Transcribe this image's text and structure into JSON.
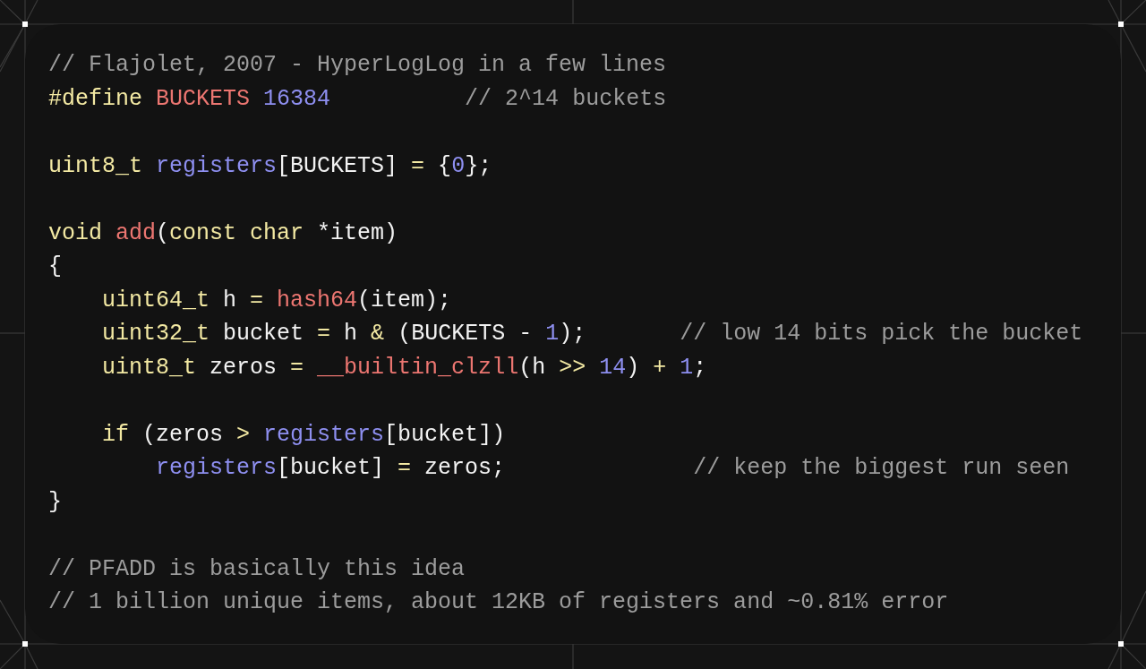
{
  "code_lines": [
    {
      "kind": "comment",
      "comment": "// Flajolet, 2007 - HyperLogLog in a few lines"
    },
    {
      "kind": "code",
      "tokens": [
        {
          "kind": "keyword",
          "text": "#define "
        },
        {
          "kind": "function",
          "text": "BUCKETS "
        },
        {
          "kind": "number",
          "text": "16384"
        }
      ],
      "comment": "          // 2^14 buckets"
    },
    {
      "kind": "blank"
    },
    {
      "kind": "code",
      "tokens": [
        {
          "kind": "keyword",
          "text": "uint8_t "
        },
        {
          "kind": "identifier",
          "text": "registers"
        },
        {
          "kind": "plain",
          "text": "[BUCKETS] "
        },
        {
          "kind": "keyword",
          "text": "="
        },
        {
          "kind": "plain",
          "text": " {"
        },
        {
          "kind": "number",
          "text": "0"
        },
        {
          "kind": "plain",
          "text": "};"
        }
      ]
    },
    {
      "kind": "blank"
    },
    {
      "kind": "code",
      "tokens": [
        {
          "kind": "keyword",
          "text": "void "
        },
        {
          "kind": "function",
          "text": "add"
        },
        {
          "kind": "plain",
          "text": "("
        },
        {
          "kind": "keyword",
          "text": "const char"
        },
        {
          "kind": "plain",
          "text": " *item)"
        }
      ]
    },
    {
      "kind": "code",
      "tokens": [
        {
          "kind": "plain",
          "text": "{"
        }
      ]
    },
    {
      "kind": "code",
      "tokens": [
        {
          "kind": "keyword",
          "text": "    uint64_t"
        },
        {
          "kind": "plain",
          "text": " h "
        },
        {
          "kind": "keyword",
          "text": "= "
        },
        {
          "kind": "function",
          "text": "hash64"
        },
        {
          "kind": "plain",
          "text": "(item);"
        }
      ]
    },
    {
      "kind": "code",
      "tokens": [
        {
          "kind": "keyword",
          "text": "    uint32_t"
        },
        {
          "kind": "plain",
          "text": " bucket "
        },
        {
          "kind": "keyword",
          "text": "="
        },
        {
          "kind": "plain",
          "text": " h "
        },
        {
          "kind": "keyword",
          "text": "&"
        },
        {
          "kind": "plain",
          "text": " (BUCKETS - "
        },
        {
          "kind": "number",
          "text": "1"
        },
        {
          "kind": "plain",
          "text": ");"
        }
      ],
      "comment": "       // low 14 bits pick the bucket"
    },
    {
      "kind": "code",
      "tokens": [
        {
          "kind": "keyword",
          "text": "    uint8_t"
        },
        {
          "kind": "plain",
          "text": " zeros "
        },
        {
          "kind": "keyword",
          "text": "= "
        },
        {
          "kind": "function",
          "text": "__builtin_clzll"
        },
        {
          "kind": "plain",
          "text": "(h "
        },
        {
          "kind": "keyword",
          "text": ">> "
        },
        {
          "kind": "number",
          "text": "14"
        },
        {
          "kind": "plain",
          "text": ") "
        },
        {
          "kind": "keyword",
          "text": "+ "
        },
        {
          "kind": "number",
          "text": "1"
        },
        {
          "kind": "plain",
          "text": ";"
        }
      ]
    },
    {
      "kind": "blank"
    },
    {
      "kind": "code",
      "tokens": [
        {
          "kind": "keyword",
          "text": "    if"
        },
        {
          "kind": "plain",
          "text": " (zeros "
        },
        {
          "kind": "keyword",
          "text": "> "
        },
        {
          "kind": "identifier",
          "text": "registers"
        },
        {
          "kind": "plain",
          "text": "[bucket])"
        }
      ]
    },
    {
      "kind": "code",
      "tokens": [
        {
          "kind": "identifier",
          "text": "        registers"
        },
        {
          "kind": "plain",
          "text": "[bucket] "
        },
        {
          "kind": "keyword",
          "text": "="
        },
        {
          "kind": "plain",
          "text": " zeros;"
        }
      ],
      "comment": "              // keep the biggest run seen"
    },
    {
      "kind": "code",
      "tokens": [
        {
          "kind": "plain",
          "text": "}"
        }
      ]
    },
    {
      "kind": "blank"
    },
    {
      "kind": "comment",
      "comment": "// PFADD is basically this idea"
    },
    {
      "kind": "comment",
      "comment": "// 1 billion unique items, about 12KB of registers and ~0.81% error"
    }
  ]
}
